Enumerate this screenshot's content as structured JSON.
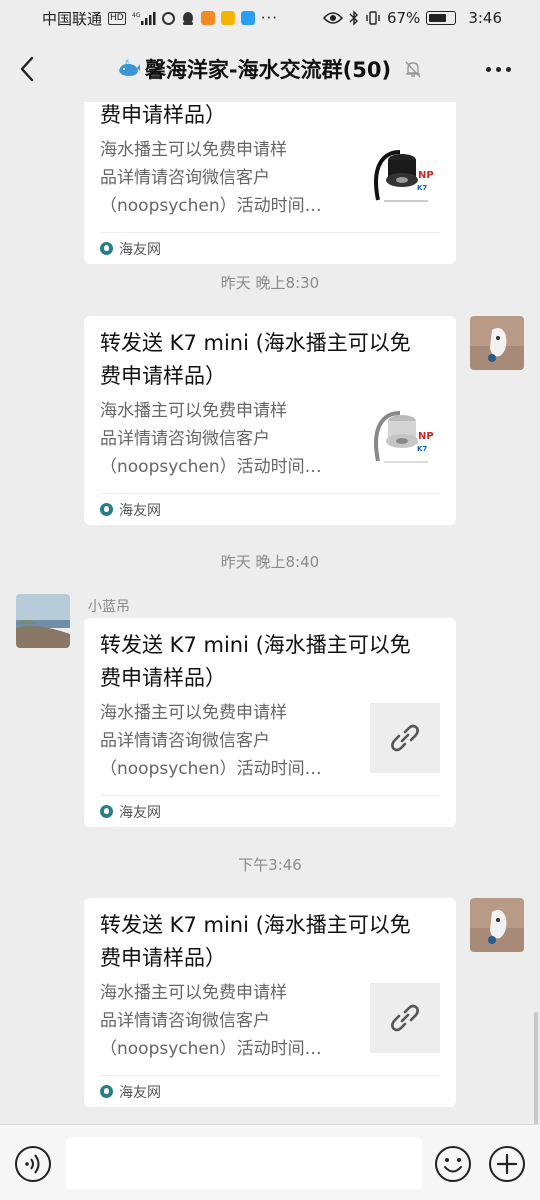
{
  "status_bar": {
    "carrier": "中国联通",
    "battery": "67%",
    "battery_level": 0.67,
    "time": "3:46"
  },
  "nav": {
    "title": "馨海洋家-海水交流群(50)",
    "title_icon": "whale-icon"
  },
  "messages": [
    {
      "side": "left",
      "card": {
        "title": "费申请样品）",
        "desc_lines": [
          "海水播主可以免费申请样",
          "品详情请咨询微信客户",
          "（noopsychen）活动时间…"
        ],
        "thumb": "pump-product-image-dark",
        "source": "海友网"
      }
    },
    {
      "time": "昨天 晚上8:30",
      "side": "right",
      "card": {
        "title_lines": [
          "转发送 K7 mini (海水播主可以免",
          "费申请样品）"
        ],
        "desc_lines": [
          "海水播主可以免费申请样",
          "品详情请咨询微信客户",
          "（noopsychen）活动时间…"
        ],
        "thumb": "pump-product-image-light",
        "source": "海友网"
      }
    },
    {
      "time": "昨天 晚上8:40",
      "side": "left",
      "sender": "小蓝吊",
      "card": {
        "title_lines": [
          "转发送 K7 mini (海水播主可以免",
          "费申请样品）"
        ],
        "desc_lines": [
          "海水播主可以免费申请样",
          "品详情请咨询微信客户",
          "（noopsychen）活动时间…"
        ],
        "thumb": "link-icon",
        "source": "海友网"
      }
    },
    {
      "time": "下午3:46",
      "side": "right",
      "card": {
        "title_lines": [
          "转发送 K7 mini (海水播主可以免",
          "费申请样品）"
        ],
        "desc_lines": [
          "海水播主可以免费申请样",
          "品详情请咨询微信客户",
          "（noopsychen）活动时间…"
        ],
        "thumb": "link-icon",
        "source": "海友网"
      }
    }
  ],
  "colors": {
    "background": "#ededed",
    "card": "#ffffff",
    "meta_text": "#8a8a8a",
    "source_icon": "#2a7f86"
  }
}
